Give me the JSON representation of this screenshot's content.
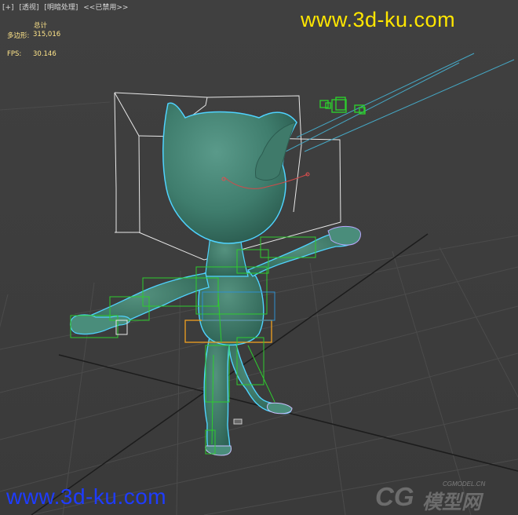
{
  "viewport": {
    "labels": [
      "[+]",
      "[透视]",
      "[明暗处理]",
      "<<已禁用>>"
    ]
  },
  "stats": {
    "total_label": "总计",
    "polys_label": "多边形:",
    "polys_value": "315,016",
    "fps_label": "FPS:",
    "fps_value": "30.146"
  },
  "watermark": {
    "top": "www.3d-ku.com",
    "bottom": "www.3d-ku.com",
    "logo_big": "CG",
    "logo_cn": "模型网",
    "logo_small": "CGMODEL.CN"
  },
  "colors": {
    "background": "#3d3d3d",
    "grid": "#4a4a4a",
    "grid_main": "#1c1c1c",
    "bbox": "#e6e6e6",
    "model": "#3a8070",
    "model_outline": "#4fd3ff",
    "bone_green": "#2ecc2e",
    "bone_yellow": "#f0a020",
    "stats_text": "#ffe58a",
    "wm_top": "#ffe600",
    "wm_bottom": "#1e3cff"
  }
}
